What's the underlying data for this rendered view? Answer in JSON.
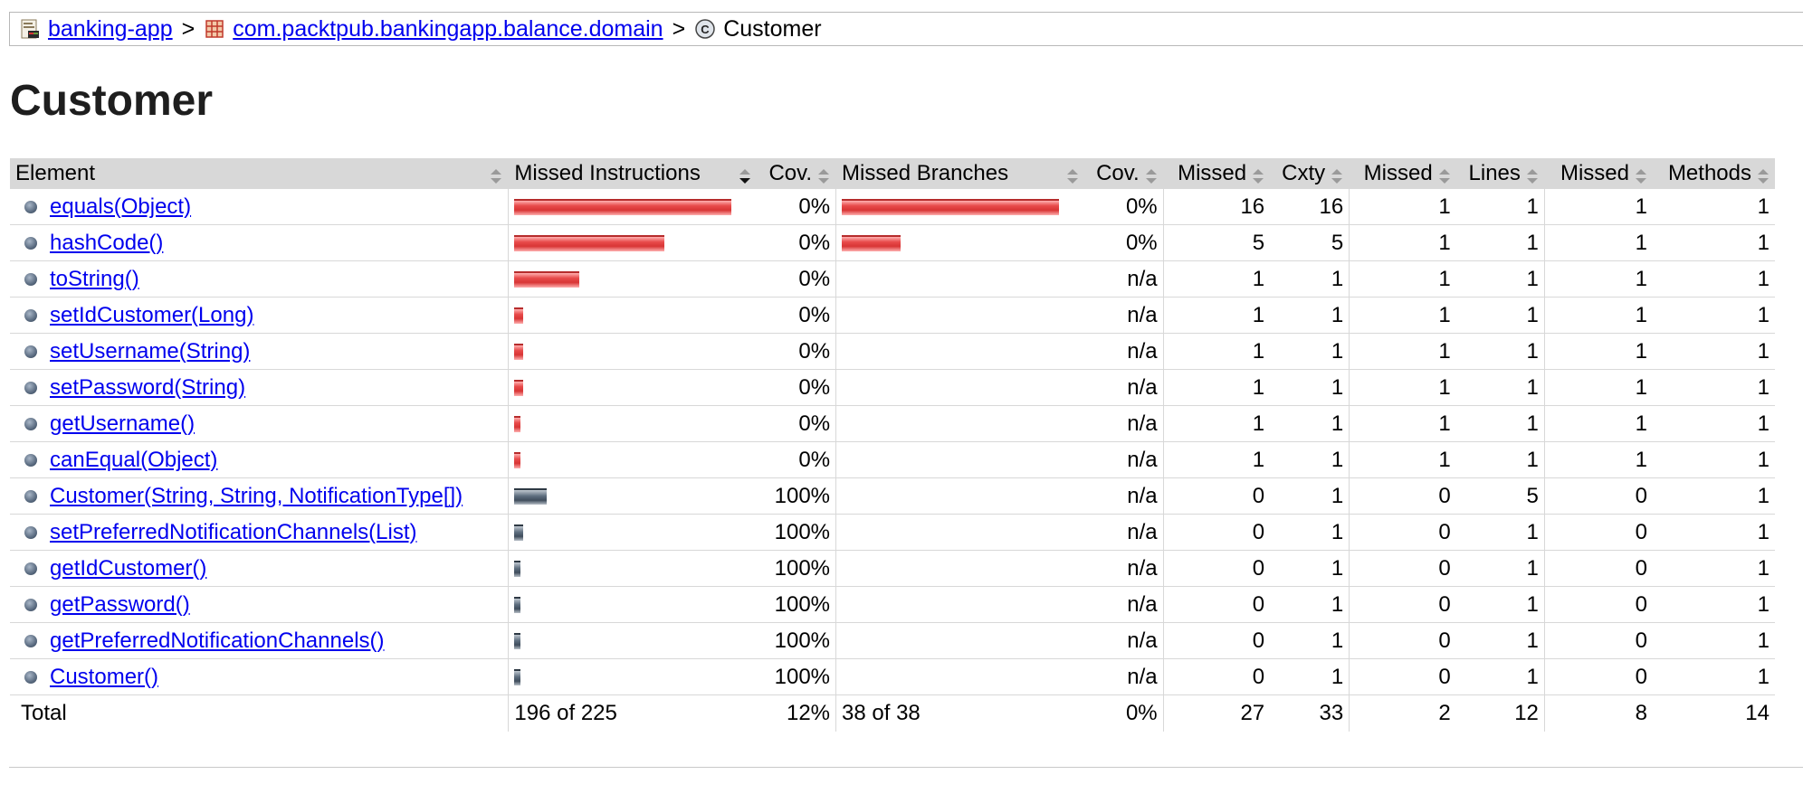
{
  "breadcrumb": {
    "project": "banking-app",
    "package": "com.packtpub.bankingapp.balance.domain",
    "current": "Customer",
    "separator": ">"
  },
  "page_title": "Customer",
  "table": {
    "headers": {
      "element": "Element",
      "missed_instructions": "Missed Instructions",
      "cov1": "Cov.",
      "missed_branches": "Missed Branches",
      "cov2": "Cov.",
      "missed_cxty": "Missed",
      "cxty": "Cxty",
      "missed_lines": "Missed",
      "lines": "Lines",
      "missed_methods": "Missed",
      "methods": "Methods"
    },
    "rows": [
      {
        "name": "equals(Object)",
        "instr_missed_frac": 1.0,
        "instr_cov_frac": 0,
        "instr_cov": "0%",
        "branch_missed_frac": 1.0,
        "branch_cov_frac": 0,
        "branch_cov": "0%",
        "missed_cxty": "16",
        "cxty": "16",
        "missed_lines": "1",
        "lines": "1",
        "missed_methods": "1",
        "methods": "1"
      },
      {
        "name": "hashCode()",
        "instr_missed_frac": 0.69,
        "instr_cov_frac": 0,
        "instr_cov": "0%",
        "branch_missed_frac": 0.27,
        "branch_cov_frac": 0,
        "branch_cov": "0%",
        "missed_cxty": "5",
        "cxty": "5",
        "missed_lines": "1",
        "lines": "1",
        "missed_methods": "1",
        "methods": "1"
      },
      {
        "name": "toString()",
        "instr_missed_frac": 0.3,
        "instr_cov_frac": 0,
        "instr_cov": "0%",
        "branch_missed_frac": 0,
        "branch_cov_frac": 0,
        "branch_cov": "n/a",
        "missed_cxty": "1",
        "cxty": "1",
        "missed_lines": "1",
        "lines": "1",
        "missed_methods": "1",
        "methods": "1"
      },
      {
        "name": "setIdCustomer(Long)",
        "instr_missed_frac": 0.04,
        "instr_cov_frac": 0,
        "instr_cov": "0%",
        "branch_missed_frac": 0,
        "branch_cov_frac": 0,
        "branch_cov": "n/a",
        "missed_cxty": "1",
        "cxty": "1",
        "missed_lines": "1",
        "lines": "1",
        "missed_methods": "1",
        "methods": "1"
      },
      {
        "name": "setUsername(String)",
        "instr_missed_frac": 0.04,
        "instr_cov_frac": 0,
        "instr_cov": "0%",
        "branch_missed_frac": 0,
        "branch_cov_frac": 0,
        "branch_cov": "n/a",
        "missed_cxty": "1",
        "cxty": "1",
        "missed_lines": "1",
        "lines": "1",
        "missed_methods": "1",
        "methods": "1"
      },
      {
        "name": "setPassword(String)",
        "instr_missed_frac": 0.04,
        "instr_cov_frac": 0,
        "instr_cov": "0%",
        "branch_missed_frac": 0,
        "branch_cov_frac": 0,
        "branch_cov": "n/a",
        "missed_cxty": "1",
        "cxty": "1",
        "missed_lines": "1",
        "lines": "1",
        "missed_methods": "1",
        "methods": "1"
      },
      {
        "name": "getUsername()",
        "instr_missed_frac": 0.03,
        "instr_cov_frac": 0,
        "instr_cov": "0%",
        "branch_missed_frac": 0,
        "branch_cov_frac": 0,
        "branch_cov": "n/a",
        "missed_cxty": "1",
        "cxty": "1",
        "missed_lines": "1",
        "lines": "1",
        "missed_methods": "1",
        "methods": "1"
      },
      {
        "name": "canEqual(Object)",
        "instr_missed_frac": 0.03,
        "instr_cov_frac": 0,
        "instr_cov": "0%",
        "branch_missed_frac": 0,
        "branch_cov_frac": 0,
        "branch_cov": "n/a",
        "missed_cxty": "1",
        "cxty": "1",
        "missed_lines": "1",
        "lines": "1",
        "missed_methods": "1",
        "methods": "1"
      },
      {
        "name": "Customer(String, String, NotificationType[])",
        "instr_missed_frac": 0,
        "instr_cov_frac": 0.15,
        "instr_cov": "100%",
        "branch_missed_frac": 0,
        "branch_cov_frac": 0,
        "branch_cov": "n/a",
        "missed_cxty": "0",
        "cxty": "1",
        "missed_lines": "0",
        "lines": "5",
        "missed_methods": "0",
        "methods": "1"
      },
      {
        "name": "setPreferredNotificationChannels(List)",
        "instr_missed_frac": 0,
        "instr_cov_frac": 0.04,
        "instr_cov": "100%",
        "branch_missed_frac": 0,
        "branch_cov_frac": 0,
        "branch_cov": "n/a",
        "missed_cxty": "0",
        "cxty": "1",
        "missed_lines": "0",
        "lines": "1",
        "missed_methods": "0",
        "methods": "1"
      },
      {
        "name": "getIdCustomer()",
        "instr_missed_frac": 0,
        "instr_cov_frac": 0.03,
        "instr_cov": "100%",
        "branch_missed_frac": 0,
        "branch_cov_frac": 0,
        "branch_cov": "n/a",
        "missed_cxty": "0",
        "cxty": "1",
        "missed_lines": "0",
        "lines": "1",
        "missed_methods": "0",
        "methods": "1"
      },
      {
        "name": "getPassword()",
        "instr_missed_frac": 0,
        "instr_cov_frac": 0.03,
        "instr_cov": "100%",
        "branch_missed_frac": 0,
        "branch_cov_frac": 0,
        "branch_cov": "n/a",
        "missed_cxty": "0",
        "cxty": "1",
        "missed_lines": "0",
        "lines": "1",
        "missed_methods": "0",
        "methods": "1"
      },
      {
        "name": "getPreferredNotificationChannels()",
        "instr_missed_frac": 0,
        "instr_cov_frac": 0.03,
        "instr_cov": "100%",
        "branch_missed_frac": 0,
        "branch_cov_frac": 0,
        "branch_cov": "n/a",
        "missed_cxty": "0",
        "cxty": "1",
        "missed_lines": "0",
        "lines": "1",
        "missed_methods": "0",
        "methods": "1"
      },
      {
        "name": "Customer()",
        "instr_missed_frac": 0,
        "instr_cov_frac": 0.03,
        "instr_cov": "100%",
        "branch_missed_frac": 0,
        "branch_cov_frac": 0,
        "branch_cov": "n/a",
        "missed_cxty": "0",
        "cxty": "1",
        "missed_lines": "0",
        "lines": "1",
        "missed_methods": "0",
        "methods": "1"
      }
    ],
    "total": {
      "label": "Total",
      "instructions": "196 of 225",
      "instr_cov": "12%",
      "branches": "38 of 38",
      "branch_cov": "0%",
      "missed_cxty": "27",
      "cxty": "33",
      "missed_lines": "2",
      "lines": "12",
      "missed_methods": "8",
      "methods": "14"
    }
  },
  "colors": {
    "link": "#0000ee",
    "header_bg": "#d8d8d8",
    "missed_bar": "#d83535",
    "covered_bar": "#4a5868"
  },
  "icons": {
    "project": "report-icon",
    "package": "package-icon",
    "class": "class-icon",
    "sort": "sort-arrows-icon",
    "method": "method-bullet-icon"
  }
}
